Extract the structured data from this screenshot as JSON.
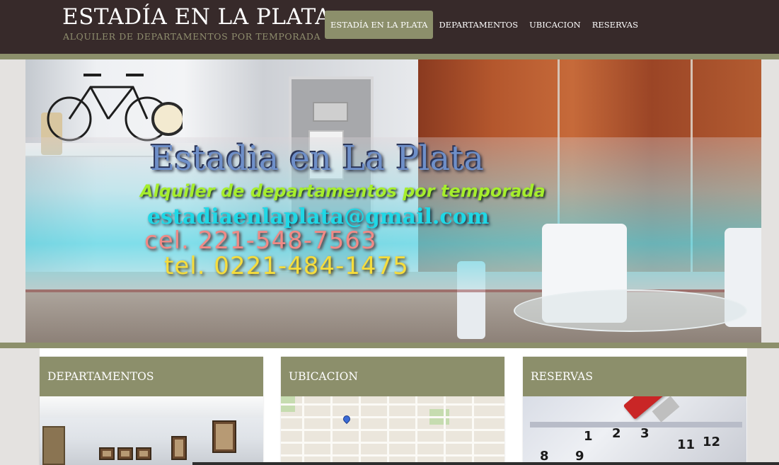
{
  "header": {
    "site_title": "ESTADÍA EN LA PLATA",
    "tagline": "ALQUILER DE DEPARTAMENTOS POR TEMPORADA"
  },
  "nav": {
    "items": [
      {
        "label": "ESTADÍA EN LA PLATA",
        "active": true
      },
      {
        "label": "DEPARTAMENTOS",
        "active": false
      },
      {
        "label": "UBICACION",
        "active": false
      },
      {
        "label": "RESERVAS",
        "active": false
      }
    ]
  },
  "banner": {
    "title": "Estadia en La Plata",
    "subtitle": "Alquiler de departamentos por temporada",
    "email": "estadiaenlaplata@gmail.com",
    "cel": "cel. 221-548-7563",
    "tel": "tel. 0221-484-1475"
  },
  "cards": [
    {
      "title": "DEPARTAMENTOS",
      "image": "apartment-photo"
    },
    {
      "title": "UBICACION",
      "image": "street-map"
    },
    {
      "title": "RESERVAS",
      "image": "calendar-with-pencil"
    }
  ],
  "theme": {
    "header_bg": "#372a2a",
    "accent": "#8c8f6b",
    "tagline_color": "#8f8e6e",
    "page_bg": "#e4e2e0"
  }
}
